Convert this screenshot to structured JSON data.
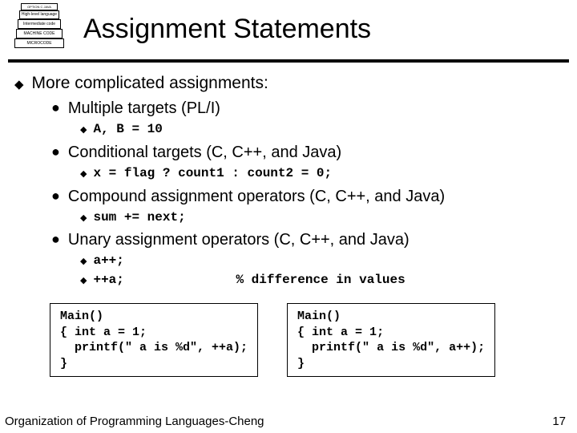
{
  "icon": {
    "levels": [
      "OPTION   C   JAVA",
      "High-level language",
      "Intermediate code",
      "MACHINE CODE",
      "MICROCODE"
    ]
  },
  "title": "Assignment Statements",
  "bullet1": "More complicated assignments:",
  "items": [
    {
      "label": "Multiple targets  (PL/I)",
      "code": [
        {
          "text": "A, B = 10",
          "note": ""
        }
      ]
    },
    {
      "label": "Conditional targets (C, C++, and Java)",
      "code": [
        {
          "text": "x = flag ? count1 : count2 = 0;",
          "note": ""
        }
      ]
    },
    {
      "label": "Compound assignment operators (C, C++, and Java)",
      "code": [
        {
          "text": "sum += next;",
          "note": ""
        }
      ]
    },
    {
      "label": "Unary assignment operators (C, C++, and Java)",
      "code": [
        {
          "text": "a++;",
          "note": ""
        },
        {
          "text": "++a;",
          "note": "% difference in values"
        }
      ]
    }
  ],
  "codeboxes": [
    "Main()\n{ int a = 1;\n  printf(\" a is %d\", ++a);\n}",
    "Main()\n{ int a = 1;\n  printf(\" a is %d\", a++);\n}"
  ],
  "footer": "Organization of Programming Languages-Cheng",
  "pagenum": "17"
}
